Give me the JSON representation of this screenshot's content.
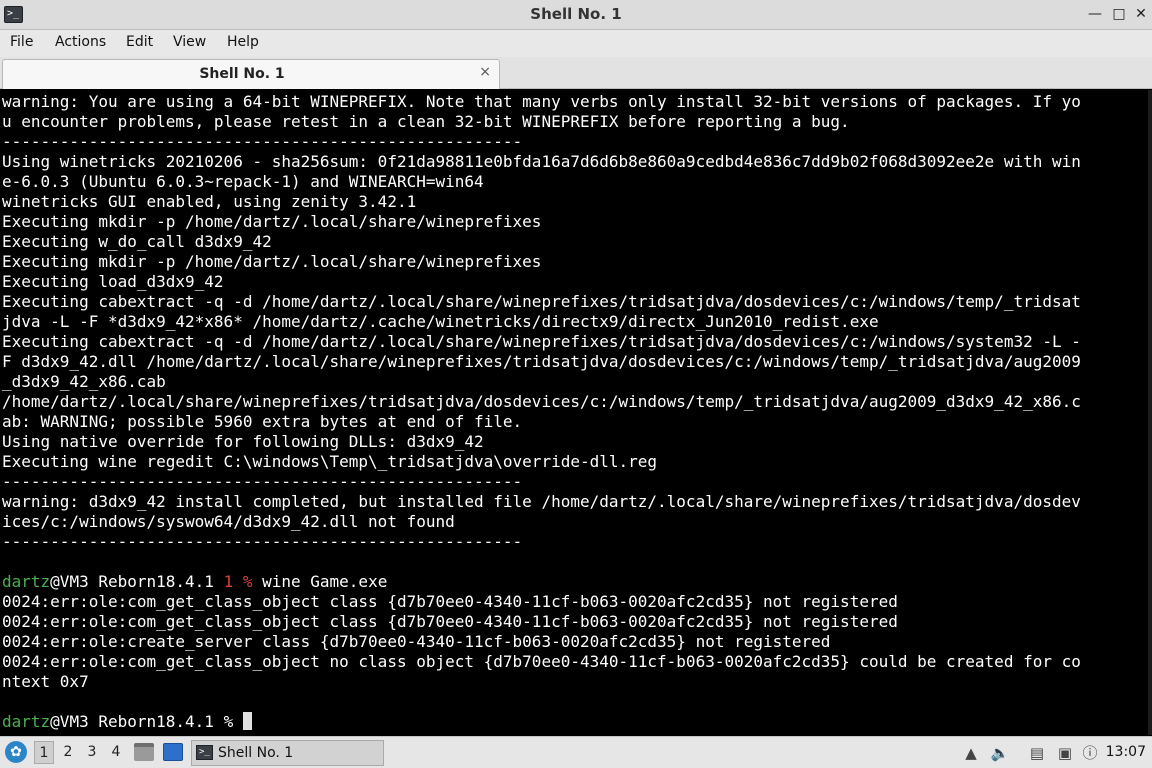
{
  "window": {
    "title": "Shell No. 1",
    "icon": "terminal-icon",
    "controls": [
      "minimize",
      "maximize",
      "close"
    ]
  },
  "menu": [
    "File",
    "Actions",
    "Edit",
    "View",
    "Help"
  ],
  "tab": {
    "label": "Shell No. 1",
    "close": "×"
  },
  "terminal": {
    "lines": [
      {
        "text": "warning: You are using a 64-bit WINEPREFIX. Note that many verbs only install 32-bit versions of packages. If yo"
      },
      {
        "text": "u encounter problems, please retest in a clean 32-bit WINEPREFIX before reporting a bug."
      },
      {
        "text": "------------------------------------------------------"
      },
      {
        "text": "Using winetricks 20210206 - sha256sum: 0f21da98811e0bfda16a7d6d6b8e860a9cedbd4e836c7dd9b02f068d3092ee2e with win"
      },
      {
        "text": "e-6.0.3 (Ubuntu 6.0.3~repack-1) and WINEARCH=win64"
      },
      {
        "text": "winetricks GUI enabled, using zenity 3.42.1"
      },
      {
        "text": "Executing mkdir -p /home/dartz/.local/share/wineprefixes"
      },
      {
        "text": "Executing w_do_call d3dx9_42"
      },
      {
        "text": "Executing mkdir -p /home/dartz/.local/share/wineprefixes"
      },
      {
        "text": "Executing load_d3dx9_42"
      },
      {
        "text": "Executing cabextract -q -d /home/dartz/.local/share/wineprefixes/tridsatjdva/dosdevices/c:/windows/temp/_tridsat"
      },
      {
        "text": "jdva -L -F *d3dx9_42*x86* /home/dartz/.cache/winetricks/directx9/directx_Jun2010_redist.exe"
      },
      {
        "text": "Executing cabextract -q -d /home/dartz/.local/share/wineprefixes/tridsatjdva/dosdevices/c:/windows/system32 -L -"
      },
      {
        "text": "F d3dx9_42.dll /home/dartz/.local/share/wineprefixes/tridsatjdva/dosdevices/c:/windows/temp/_tridsatjdva/aug2009"
      },
      {
        "text": "_d3dx9_42_x86.cab"
      },
      {
        "text": "/home/dartz/.local/share/wineprefixes/tridsatjdva/dosdevices/c:/windows/temp/_tridsatjdva/aug2009_d3dx9_42_x86.c"
      },
      {
        "text": "ab: WARNING; possible 5960 extra bytes at end of file."
      },
      {
        "text": "Using native override for following DLLs: d3dx9_42"
      },
      {
        "text": "Executing wine regedit C:\\windows\\Temp\\_tridsatjdva\\override-dll.reg"
      },
      {
        "text": "------------------------------------------------------"
      },
      {
        "text": "warning: d3dx9_42 install completed, but installed file /home/dartz/.local/share/wineprefixes/tridsatjdva/dosdev"
      },
      {
        "text": "ices/c:/windows/syswow64/d3dx9_42.dll not found"
      },
      {
        "text": "------------------------------------------------------"
      },
      {
        "text": ""
      },
      {
        "prompt": {
          "user": "dartz",
          "host": "@VM3 Reborn18.4.1 ",
          "status": "1 %",
          "command": " wine Game.exe"
        }
      },
      {
        "text": "0024:err:ole:com_get_class_object class {d7b70ee0-4340-11cf-b063-0020afc2cd35} not registered"
      },
      {
        "text": "0024:err:ole:com_get_class_object class {d7b70ee0-4340-11cf-b063-0020afc2cd35} not registered"
      },
      {
        "text": "0024:err:ole:create_server class {d7b70ee0-4340-11cf-b063-0020afc2cd35} not registered"
      },
      {
        "text": "0024:err:ole:com_get_class_object no class object {d7b70ee0-4340-11cf-b063-0020afc2cd35} could be created for co"
      },
      {
        "text": "ntext 0x7"
      },
      {
        "text": ""
      },
      {
        "prompt": {
          "user": "dartz",
          "host": "@VM3 Reborn18.4.1 %",
          "status": "",
          "command": " "
        },
        "cursor": true
      }
    ],
    "colors": {
      "background": "#000000",
      "text": "#ffffff",
      "user": "#4caf50",
      "status": "#d94040"
    }
  },
  "taskbar": {
    "workspaces": [
      "1",
      "2",
      "3",
      "4"
    ],
    "active_workspace": "1",
    "launchers": [
      "file-manager-icon",
      "show-desktop-icon"
    ],
    "task": {
      "label": "Shell No. 1",
      "icon": "terminal-icon"
    },
    "tray": [
      "removable-media-icon",
      "volume-icon",
      "clipboard-icon",
      "network-icon",
      "info-icon"
    ],
    "clock": "13:07"
  }
}
